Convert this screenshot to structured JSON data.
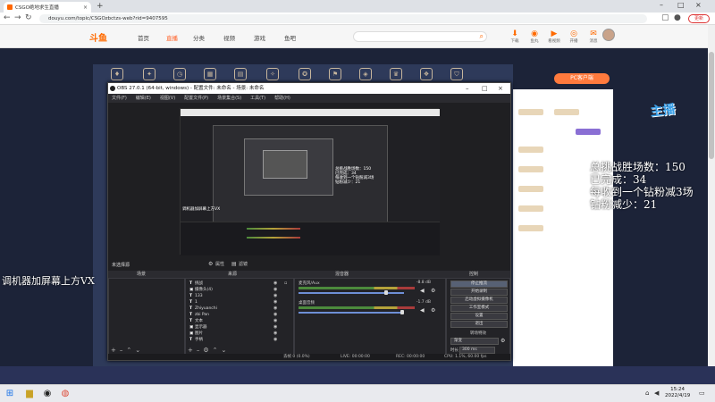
{
  "browser": {
    "tab_title": "CSGO绝地求生直播",
    "url": "douyu.com/topic/CSGOzbctzs-web?rid=9407595",
    "update_label": "更新"
  },
  "site": {
    "logo": "斗鱼",
    "nav": [
      "首页",
      "直播",
      "分类",
      "视频",
      "游戏",
      "鱼吧"
    ],
    "header_icons": [
      "下载",
      "鱼丸",
      "看视频",
      "开播",
      "消息"
    ],
    "pc_button": "PC客户端"
  },
  "obs": {
    "title": "OBS 27.0.1 (64-bit, windows) - 配置文件: 未命名 - 场景: 未命名",
    "menu": [
      "文件(F)",
      "编辑(E)",
      "视图(V)",
      "配置文件(P)",
      "场景集合(S)",
      "工具(T)",
      "帮助(H)"
    ],
    "nested_texts": {
      "stats": [
        "总挑战胜场数：150",
        "已完成：34",
        "每收到一个钻粉减3场",
        "钻粉减少：21"
      ],
      "left": "调机器加屏幕上方VX"
    },
    "scene_row_label": "未选择源",
    "properties_label": "属性",
    "filters_label": "滤镜",
    "dock_headers": {
      "scenes": "场景",
      "sources": "来源",
      "mixer": "混音器",
      "controls": "控制"
    },
    "sources": [
      {
        "icon": "T",
        "name": "挑战"
      },
      {
        "icon": "▣",
        "name": "摄像头(4)"
      },
      {
        "icon": "T",
        "name": "133"
      },
      {
        "icon": "T",
        "name": "1"
      },
      {
        "icon": "T",
        "name": "Zhiyuanchi"
      },
      {
        "icon": "T",
        "name": "zbi Pan"
      },
      {
        "icon": "T",
        "name": "文本"
      },
      {
        "icon": "▣",
        "name": "显示器"
      },
      {
        "icon": "▣",
        "name": "图片"
      },
      {
        "icon": "T",
        "name": "手柄"
      }
    ],
    "mixer": [
      {
        "label": "麦克风/Aux",
        "db": "-8.8 dB"
      },
      {
        "label": "桌面音频",
        "db": "-1.7 dB"
      }
    ],
    "controls": [
      "停止推流",
      "开始录制",
      "启动虚拟摄像机",
      "工作室模式",
      "设置",
      "退出"
    ],
    "transition": {
      "title": "转场特效",
      "type": "渐变",
      "duration_label": "时长",
      "duration_value": "300 ms"
    },
    "status": {
      "drop": "丢帧 0 (0.0%)",
      "live": "LIVE: 00:00:00",
      "rec": "REC: 00:00:00",
      "cpu": "CPU: 1.1%, 60.00 fps"
    }
  },
  "overlay": {
    "stats": [
      "总挑战胜场数：150",
      "已完成：34",
      "每收到一个钻粉减3场",
      "钻粉减少：21"
    ],
    "left_text": "调机器加屏幕上方VX"
  },
  "taskbar": {
    "time": "15:24",
    "date": "2022/4/19"
  },
  "colors": {
    "douyu_orange": "#ff6a00",
    "obs_bg": "#1f1f22",
    "page_bg": "#1c2338"
  }
}
